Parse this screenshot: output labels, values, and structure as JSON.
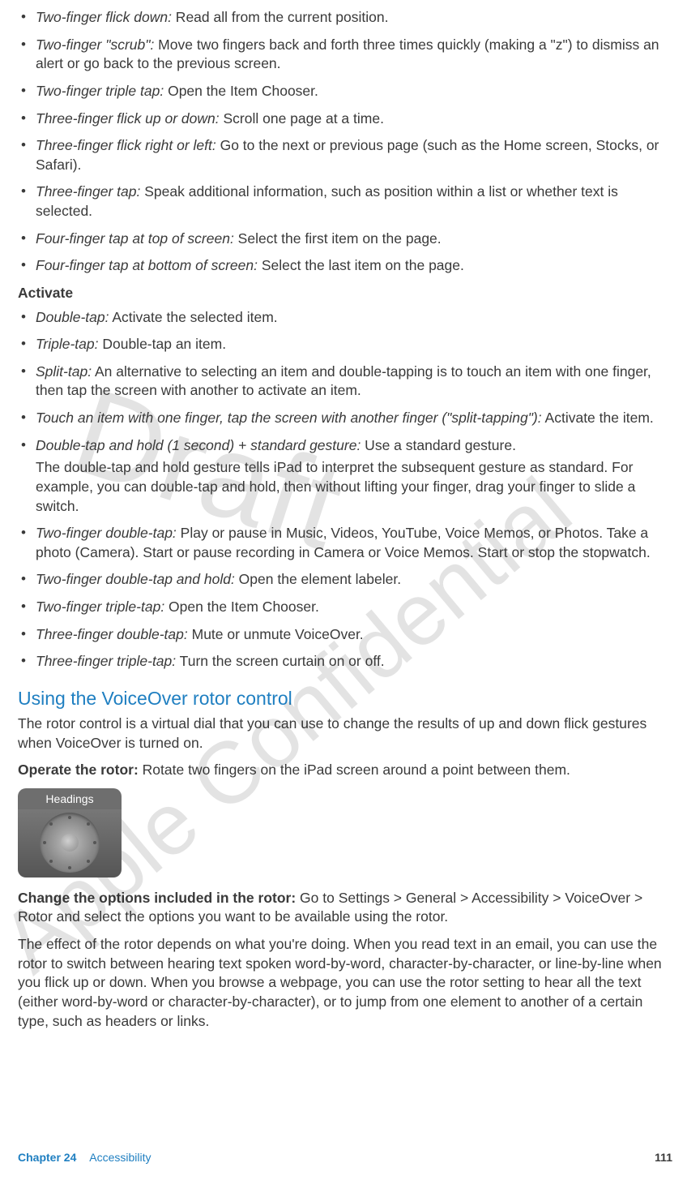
{
  "watermarks": {
    "draft": "Draft",
    "confidential": "Apple Confidential"
  },
  "nav_group": {
    "items": [
      {
        "term": "Two-finger flick down:",
        "desc": "  Read all from the current position."
      },
      {
        "term": "Two-finger \"scrub\":",
        "desc": "  Move two fingers back and forth three times quickly (making a \"z\") to dismiss an alert or go back to the previous screen."
      },
      {
        "term": "Two-finger triple tap:",
        "desc": "  Open the Item Chooser."
      },
      {
        "term": "Three-finger flick up or down:",
        "desc": "  Scroll one page at a time."
      },
      {
        "term": "Three-finger flick right or left:",
        "desc": "  Go to the next or previous page (such as the Home screen, Stocks, or Safari)."
      },
      {
        "term": "Three-finger tap:",
        "desc": "  Speak additional information, such as position within a list or whether text is selected."
      },
      {
        "term": "Four-finger tap at top of screen:",
        "desc": "  Select the first item on the page."
      },
      {
        "term": "Four-finger tap at bottom of screen:",
        "desc": "  Select the last item on the page."
      }
    ]
  },
  "activate_group": {
    "heading": "Activate",
    "items": [
      {
        "term": "Double-tap:",
        "desc": "  Activate the selected item."
      },
      {
        "term": "Triple-tap:",
        "desc": "  Double-tap an item."
      },
      {
        "term": "Split-tap:",
        "desc": "  An alternative to selecting an item and double-tapping is to touch an item with one finger, then tap the screen with another to activate an item."
      },
      {
        "term": "Touch an item with one finger, tap the screen with another finger (\"split-tapping\"):",
        "desc": "  Activate the item."
      },
      {
        "term": "Double-tap and hold (1 second) + standard gesture:",
        "desc": "  Use a standard gesture.",
        "extra": "The double-tap and hold gesture tells iPad to interpret the subsequent gesture as standard. For example, you can double-tap and hold, then without lifting your finger, drag your finger to slide a switch."
      },
      {
        "term": "Two-finger double-tap:",
        "desc": "  Play or pause in Music, Videos, YouTube, Voice Memos, or Photos. Take a photo (Camera). Start or pause recording in Camera or Voice Memos. Start or stop the stopwatch."
      },
      {
        "term": "Two-finger double-tap and hold:",
        "desc": "  Open the element labeler."
      },
      {
        "term": "Two-finger triple-tap:",
        "desc": "  Open the Item Chooser."
      },
      {
        "term": "Three-finger double-tap:",
        "desc": "  Mute or unmute VoiceOver."
      },
      {
        "term": "Three-finger triple-tap:",
        "desc": "  Turn the screen curtain on or off."
      }
    ]
  },
  "rotor_section": {
    "heading": "Using the VoiceOver rotor control",
    "intro": "The rotor control is a virtual dial that you can use to change the results of up and down flick gestures when VoiceOver is turned on.",
    "operate_label": "Operate the rotor:",
    "operate_desc": "  Rotate two fingers on the iPad screen around a point between them.",
    "figure_label": "Headings",
    "change_label": "Change the options included in the rotor:",
    "change_desc": "  Go to Settings > General > Accessibility > VoiceOver > Rotor and select the options you want to be available using the rotor.",
    "effect": "The effect of the rotor depends on what you're doing. When you read text in an email, you can use the rotor to switch between hearing text spoken word-by-word, character-by-character, or line-by-line when you flick up or down. When you browse a webpage, you can use the rotor setting to hear all the text (either word-by-word or character-by-character), or to jump from one element to another of a certain type, such as headers or links."
  },
  "footer": {
    "chapter_label": "Chapter 24",
    "chapter_title": "Accessibility",
    "page_num": "111"
  }
}
